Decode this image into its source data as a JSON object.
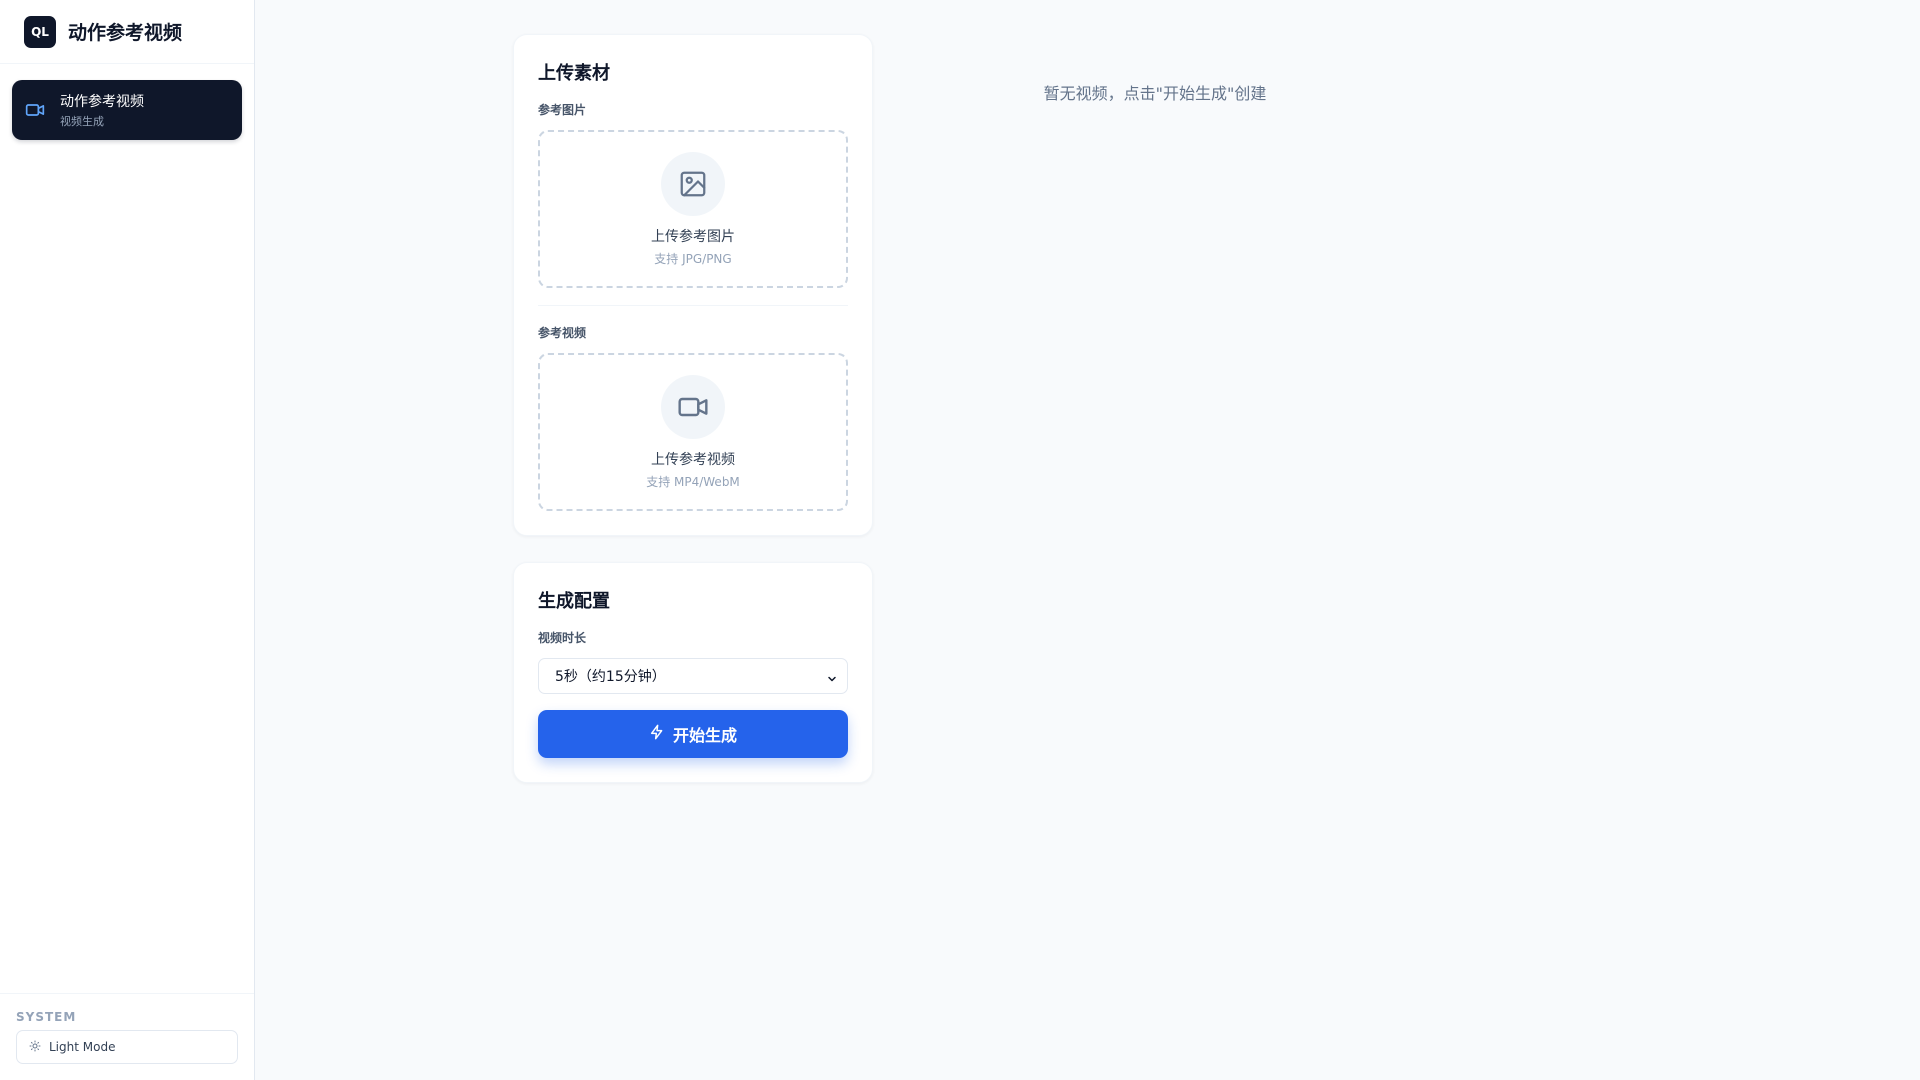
{
  "sidebar": {
    "logo": "QL",
    "title": "动作参考视频",
    "nav": [
      {
        "label": "动作参考视频",
        "sub": "视频生成",
        "icon": "video-icon"
      }
    ],
    "footer": {
      "section_title": "SYSTEM",
      "theme_label": "Light Mode",
      "theme_icon": "sun-icon"
    }
  },
  "upload_card": {
    "title": "上传素材",
    "image": {
      "label": "参考图片",
      "title": "上传参考图片",
      "hint": "支持 JPG/PNG",
      "icon": "image-icon"
    },
    "video": {
      "label": "参考视频",
      "title": "上传参考视频",
      "hint": "支持 MP4/WebM",
      "icon": "video-icon"
    }
  },
  "config_card": {
    "title": "生成配置",
    "duration_label": "视频时长",
    "duration_value": "5秒（约15分钟）",
    "generate_label": "开始生成",
    "generate_icon": "lightning-icon"
  },
  "preview": {
    "empty_text": "暂无视频，点击\"开始生成\"创建"
  },
  "colors": {
    "primary": "#2563eb",
    "dark": "#0f172a",
    "muted": "#94a3b8"
  }
}
